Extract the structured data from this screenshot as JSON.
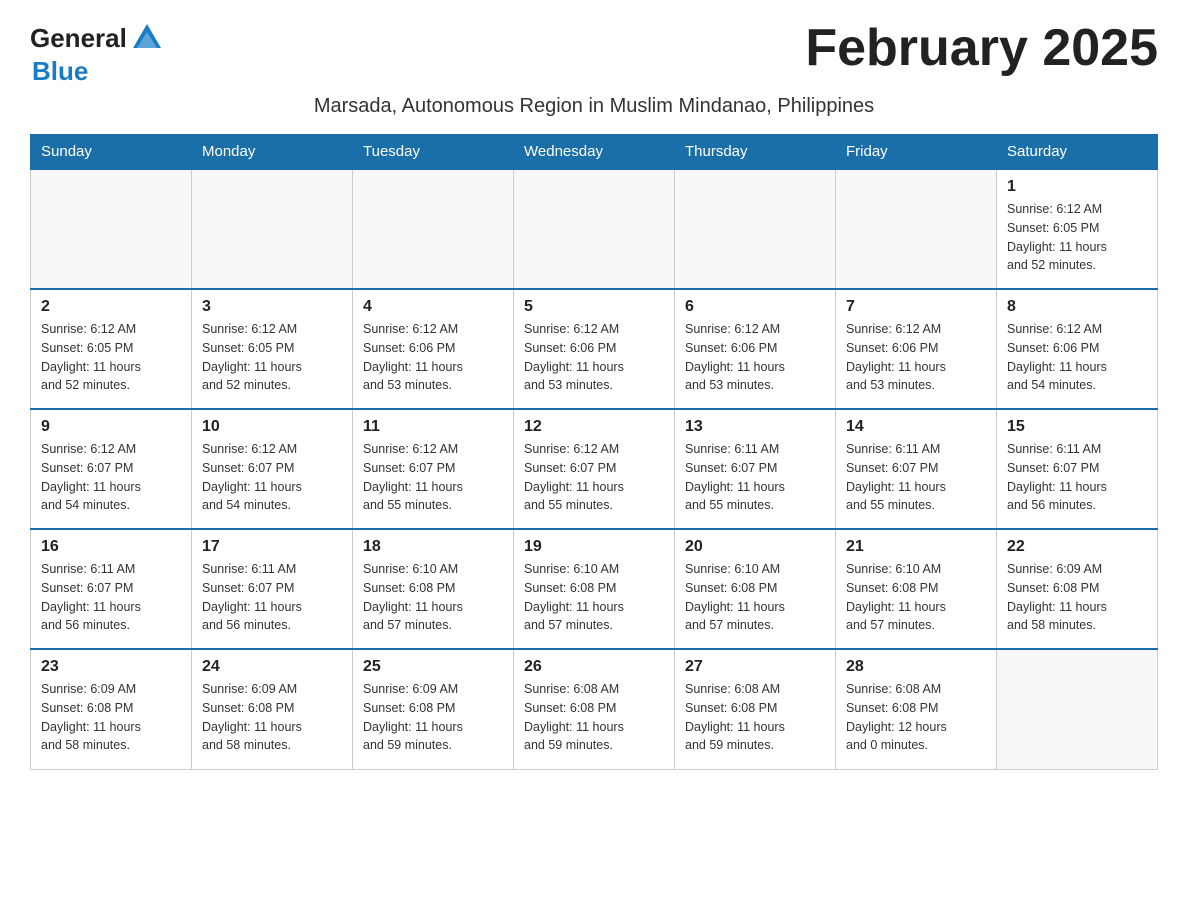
{
  "header": {
    "logo_general": "General",
    "logo_blue": "Blue",
    "month_title": "February 2025",
    "subtitle": "Marsada, Autonomous Region in Muslim Mindanao, Philippines"
  },
  "weekdays": [
    "Sunday",
    "Monday",
    "Tuesday",
    "Wednesday",
    "Thursday",
    "Friday",
    "Saturday"
  ],
  "weeks": [
    [
      {
        "day": "",
        "info": ""
      },
      {
        "day": "",
        "info": ""
      },
      {
        "day": "",
        "info": ""
      },
      {
        "day": "",
        "info": ""
      },
      {
        "day": "",
        "info": ""
      },
      {
        "day": "",
        "info": ""
      },
      {
        "day": "1",
        "info": "Sunrise: 6:12 AM\nSunset: 6:05 PM\nDaylight: 11 hours\nand 52 minutes."
      }
    ],
    [
      {
        "day": "2",
        "info": "Sunrise: 6:12 AM\nSunset: 6:05 PM\nDaylight: 11 hours\nand 52 minutes."
      },
      {
        "day": "3",
        "info": "Sunrise: 6:12 AM\nSunset: 6:05 PM\nDaylight: 11 hours\nand 52 minutes."
      },
      {
        "day": "4",
        "info": "Sunrise: 6:12 AM\nSunset: 6:06 PM\nDaylight: 11 hours\nand 53 minutes."
      },
      {
        "day": "5",
        "info": "Sunrise: 6:12 AM\nSunset: 6:06 PM\nDaylight: 11 hours\nand 53 minutes."
      },
      {
        "day": "6",
        "info": "Sunrise: 6:12 AM\nSunset: 6:06 PM\nDaylight: 11 hours\nand 53 minutes."
      },
      {
        "day": "7",
        "info": "Sunrise: 6:12 AM\nSunset: 6:06 PM\nDaylight: 11 hours\nand 53 minutes."
      },
      {
        "day": "8",
        "info": "Sunrise: 6:12 AM\nSunset: 6:06 PM\nDaylight: 11 hours\nand 54 minutes."
      }
    ],
    [
      {
        "day": "9",
        "info": "Sunrise: 6:12 AM\nSunset: 6:07 PM\nDaylight: 11 hours\nand 54 minutes."
      },
      {
        "day": "10",
        "info": "Sunrise: 6:12 AM\nSunset: 6:07 PM\nDaylight: 11 hours\nand 54 minutes."
      },
      {
        "day": "11",
        "info": "Sunrise: 6:12 AM\nSunset: 6:07 PM\nDaylight: 11 hours\nand 55 minutes."
      },
      {
        "day": "12",
        "info": "Sunrise: 6:12 AM\nSunset: 6:07 PM\nDaylight: 11 hours\nand 55 minutes."
      },
      {
        "day": "13",
        "info": "Sunrise: 6:11 AM\nSunset: 6:07 PM\nDaylight: 11 hours\nand 55 minutes."
      },
      {
        "day": "14",
        "info": "Sunrise: 6:11 AM\nSunset: 6:07 PM\nDaylight: 11 hours\nand 55 minutes."
      },
      {
        "day": "15",
        "info": "Sunrise: 6:11 AM\nSunset: 6:07 PM\nDaylight: 11 hours\nand 56 minutes."
      }
    ],
    [
      {
        "day": "16",
        "info": "Sunrise: 6:11 AM\nSunset: 6:07 PM\nDaylight: 11 hours\nand 56 minutes."
      },
      {
        "day": "17",
        "info": "Sunrise: 6:11 AM\nSunset: 6:07 PM\nDaylight: 11 hours\nand 56 minutes."
      },
      {
        "day": "18",
        "info": "Sunrise: 6:10 AM\nSunset: 6:08 PM\nDaylight: 11 hours\nand 57 minutes."
      },
      {
        "day": "19",
        "info": "Sunrise: 6:10 AM\nSunset: 6:08 PM\nDaylight: 11 hours\nand 57 minutes."
      },
      {
        "day": "20",
        "info": "Sunrise: 6:10 AM\nSunset: 6:08 PM\nDaylight: 11 hours\nand 57 minutes."
      },
      {
        "day": "21",
        "info": "Sunrise: 6:10 AM\nSunset: 6:08 PM\nDaylight: 11 hours\nand 57 minutes."
      },
      {
        "day": "22",
        "info": "Sunrise: 6:09 AM\nSunset: 6:08 PM\nDaylight: 11 hours\nand 58 minutes."
      }
    ],
    [
      {
        "day": "23",
        "info": "Sunrise: 6:09 AM\nSunset: 6:08 PM\nDaylight: 11 hours\nand 58 minutes."
      },
      {
        "day": "24",
        "info": "Sunrise: 6:09 AM\nSunset: 6:08 PM\nDaylight: 11 hours\nand 58 minutes."
      },
      {
        "day": "25",
        "info": "Sunrise: 6:09 AM\nSunset: 6:08 PM\nDaylight: 11 hours\nand 59 minutes."
      },
      {
        "day": "26",
        "info": "Sunrise: 6:08 AM\nSunset: 6:08 PM\nDaylight: 11 hours\nand 59 minutes."
      },
      {
        "day": "27",
        "info": "Sunrise: 6:08 AM\nSunset: 6:08 PM\nDaylight: 11 hours\nand 59 minutes."
      },
      {
        "day": "28",
        "info": "Sunrise: 6:08 AM\nSunset: 6:08 PM\nDaylight: 12 hours\nand 0 minutes."
      },
      {
        "day": "",
        "info": ""
      }
    ]
  ]
}
